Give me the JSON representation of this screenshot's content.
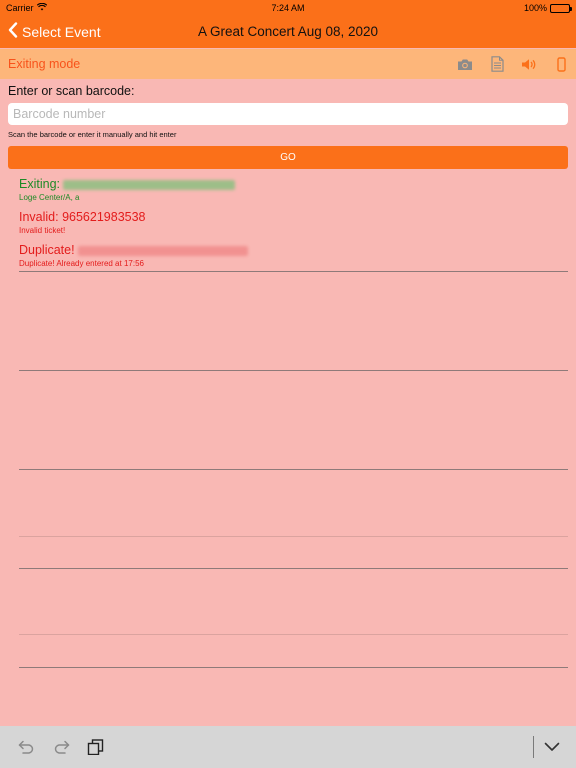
{
  "status_bar": {
    "carrier": "Carrier",
    "time": "7:24 AM",
    "battery": "100%"
  },
  "nav": {
    "back_label": "Select Event",
    "title": "A Great Concert Aug 08, 2020"
  },
  "mode_bar": {
    "label": "Exiting mode",
    "icons": [
      "camera-icon",
      "document-icon",
      "speaker-icon",
      "phone-icon"
    ]
  },
  "form": {
    "prompt": "Enter or scan barcode:",
    "placeholder": "Barcode number",
    "value": "",
    "hint": "Scan the barcode or enter it manually and hit enter",
    "go_label": "GO"
  },
  "entries": [
    {
      "status": "Exiting:",
      "detail": "Loge Center/A, a",
      "color": "#1e8a26"
    },
    {
      "status": "Invalid: 965621983538",
      "detail": "Invalid ticket!",
      "color": "#e31c1c"
    },
    {
      "status": "Duplicate!",
      "detail": "Duplicate! Already entered at 17:56",
      "color": "#e31c1c"
    }
  ],
  "colors": {
    "accent": "#fb7019",
    "mode_bar": "#fdb67a",
    "background": "#f9b8b4",
    "success": "#1e8a26",
    "error": "#e31c1c"
  },
  "toolbar": {
    "icons": [
      "undo-icon",
      "redo-icon",
      "paste-icon",
      "keyboard-dismiss-icon"
    ]
  }
}
